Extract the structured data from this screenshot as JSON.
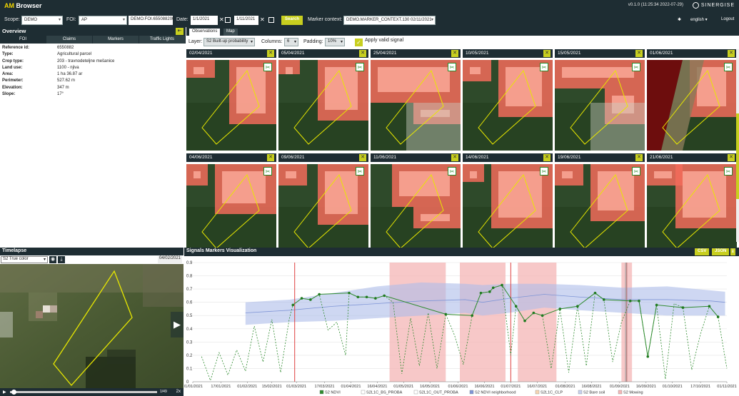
{
  "header": {
    "brand_am": "AM",
    "brand_rest": " Browser",
    "version": "v0.1.0 (11:25:34 2022-07-29)",
    "company": "SINERGISE",
    "scope_label": "Scope:",
    "scope_value": "DEMO",
    "foi_label": "FOI:",
    "foi_value": "AP",
    "foi_id": "DEMO.FOI.655088200",
    "date_label": "Date:",
    "date_from": "1/1/2021",
    "date_to": "1/11/2021",
    "search_label": "Search",
    "marker_label": "Marker context:",
    "marker_value": "DEMO.MARKER_CONTEXT.130 02/11/2021",
    "settings_icon": "gear-icon",
    "language": "english",
    "logout": "Logout"
  },
  "overview": {
    "title": "Overview",
    "tabs": [
      "FOI",
      "Claims",
      "Markers",
      "Traffic Lights"
    ],
    "properties": [
      {
        "k": "Reference id:",
        "v": "6550882"
      },
      {
        "k": "Type:",
        "v": "Agricultural parcel"
      },
      {
        "k": "Crop type:",
        "v": "203 - travnodeteljne mešanice"
      },
      {
        "k": "Land use:",
        "v": "1100 - njiva"
      },
      {
        "k": "Area:",
        "v": "1 ha 36.87 ar"
      },
      {
        "k": "Perimeter:",
        "v": "527.62 m"
      },
      {
        "k": "Elevation:",
        "v": "347 m"
      },
      {
        "k": "Slope:",
        "v": "17°"
      }
    ]
  },
  "gallery": {
    "tabs": [
      "Observations",
      "Map"
    ],
    "layer_label": "Layer:",
    "layer_value": "S2 Built-up probability",
    "columns_label": "Columns:",
    "columns_value": "6",
    "padding_label": "Padding:",
    "padding_value": "10%",
    "valid_signal_label": "Apply valid signal",
    "observations": [
      "02/04/2021",
      "05/04/2021",
      "25/04/2021",
      "10/05/2021",
      "15/05/2021",
      "01/06/2021",
      "04/06/2021",
      "09/06/2021",
      "11/06/2021",
      "14/06/2021",
      "19/06/2021",
      "21/06/2021"
    ]
  },
  "timelapse": {
    "title": "Timelapse",
    "layer": "S2 True color",
    "date": "04/02/2021",
    "counter": "1/49",
    "speed": "2x"
  },
  "signals": {
    "title": "Signals Markers Visualization",
    "csv_label": "CSV",
    "json_label": "JSON"
  },
  "colors": {
    "header_bg": "#1e2d33",
    "accent": "#c8cf1f",
    "ndvi": "#2e8b2e",
    "mowing": "#f4b6b6",
    "bare_soil": "#c6d0ee"
  },
  "chart_data": {
    "type": "line",
    "ylim": [
      0,
      0.9
    ],
    "yticks": [
      "0",
      "0.1",
      "0.2",
      "0.3",
      "0.4",
      "0.5",
      "0.6",
      "0.7",
      "0.8",
      "0.9"
    ],
    "xticks": [
      "01/01/2021",
      "17/01/2021",
      "01/02/2021",
      "15/02/2021",
      "01/03/2021",
      "17/03/2021",
      "01/04/2021",
      "16/04/2021",
      "01/05/2021",
      "16/05/2021",
      "01/06/2021",
      "16/06/2021",
      "01/07/2021",
      "16/07/2021",
      "01/08/2021",
      "16/08/2021",
      "01/09/2021",
      "16/09/2021",
      "01/10/2021",
      "17/10/2021",
      "01/11/2021"
    ],
    "xrange_days": [
      0,
      304
    ],
    "legend": [
      "S2 NDVI",
      "S2L1C_BS_PROBA",
      "S2L1C_OUT_PROBA",
      "S2 NDVI neighborhood",
      "S2L1C_CLP",
      "S2 Bare soil",
      "S2 Mowing"
    ],
    "mowing_events": [
      {
        "start": "2021-04-23",
        "end": "2021-05-25"
      },
      {
        "start": "2021-06-02",
        "end": "2021-06-28"
      },
      {
        "start": "2021-07-05",
        "end": "2021-07-27"
      },
      {
        "start": "2021-09-02",
        "end": "2021-09-08"
      }
    ],
    "red_markers": [
      "2021-02-28",
      "2021-07-01",
      "2021-09-05"
    ],
    "ndvi_neighborhood": {
      "x": [
        "2021-01-31",
        "2021-02-25",
        "2021-03-22",
        "2021-04-16",
        "2021-05-11",
        "2021-06-05",
        "2021-06-15",
        "2021-06-30",
        "2021-07-20",
        "2021-08-09",
        "2021-09-03",
        "2021-09-28",
        "2021-10-23",
        "2021-10-31"
      ],
      "mean": [
        0.52,
        0.54,
        0.57,
        0.59,
        0.61,
        0.62,
        0.6,
        0.63,
        0.66,
        0.64,
        0.62,
        0.62,
        0.61,
        0.6
      ],
      "low": [
        0.43,
        0.45,
        0.46,
        0.48,
        0.5,
        0.52,
        0.5,
        0.52,
        0.56,
        0.54,
        0.52,
        0.5,
        0.5,
        0.5
      ],
      "high": [
        0.6,
        0.62,
        0.67,
        0.72,
        0.75,
        0.74,
        0.73,
        0.74,
        0.74,
        0.73,
        0.71,
        0.72,
        0.69,
        0.68
      ]
    },
    "ndvi_valid": {
      "x": [
        "2021-02-27",
        "2021-03-04",
        "2021-03-09",
        "2021-03-14",
        "2021-03-31",
        "2021-04-05",
        "2021-04-10",
        "2021-04-15",
        "2021-04-20",
        "2021-05-25",
        "2021-06-09",
        "2021-06-14",
        "2021-06-19",
        "2021-06-21",
        "2021-06-26",
        "2021-07-04",
        "2021-07-09",
        "2021-07-14",
        "2021-07-19",
        "2021-07-29",
        "2021-08-08",
        "2021-08-18",
        "2021-08-23",
        "2021-09-07",
        "2021-09-12",
        "2021-09-17",
        "2021-09-22",
        "2021-10-07",
        "2021-10-22",
        "2021-10-27"
      ],
      "y": [
        0.58,
        0.63,
        0.62,
        0.66,
        0.67,
        0.64,
        0.64,
        0.63,
        0.65,
        0.51,
        0.5,
        0.67,
        0.68,
        0.71,
        0.73,
        0.57,
        0.46,
        0.52,
        0.5,
        0.55,
        0.57,
        0.67,
        0.62,
        0.61,
        0.61,
        0.19,
        0.58,
        0.56,
        0.57,
        0.49
      ]
    },
    "ndvi_all": {
      "x": [
        "2021-01-06",
        "2021-01-11",
        "2021-01-16",
        "2021-01-21",
        "2021-01-26",
        "2021-01-31",
        "2021-02-05",
        "2021-02-10",
        "2021-02-15",
        "2021-02-20",
        "2021-02-25",
        "2021-02-27",
        "2021-03-04",
        "2021-03-09",
        "2021-03-14",
        "2021-03-19",
        "2021-03-24",
        "2021-03-29",
        "2021-03-31",
        "2021-04-05",
        "2021-04-10",
        "2021-04-15",
        "2021-04-20",
        "2021-04-25",
        "2021-04-30",
        "2021-05-05",
        "2021-05-10",
        "2021-05-15",
        "2021-05-20",
        "2021-05-25",
        "2021-05-30",
        "2021-06-04",
        "2021-06-09",
        "2021-06-14",
        "2021-06-19",
        "2021-06-21",
        "2021-06-26",
        "2021-07-01",
        "2021-07-04",
        "2021-07-09",
        "2021-07-14",
        "2021-07-19",
        "2021-07-24",
        "2021-07-29",
        "2021-08-03",
        "2021-08-08",
        "2021-08-13",
        "2021-08-18",
        "2021-08-23",
        "2021-08-28",
        "2021-09-02",
        "2021-09-07",
        "2021-09-12",
        "2021-09-17",
        "2021-09-22",
        "2021-09-27",
        "2021-10-02",
        "2021-10-07",
        "2021-10-12",
        "2021-10-17",
        "2021-10-22",
        "2021-10-27",
        "2021-11-01"
      ],
      "y": [
        0.19,
        0.01,
        0.22,
        0.05,
        0.24,
        0.08,
        0.42,
        0.15,
        0.47,
        0.07,
        0.48,
        0.58,
        0.63,
        0.62,
        0.66,
        0.39,
        0.45,
        0.2,
        0.67,
        0.64,
        0.64,
        0.63,
        0.65,
        0.6,
        0.06,
        0.48,
        0.12,
        0.52,
        0.1,
        0.51,
        0.35,
        0.13,
        0.5,
        0.67,
        0.68,
        0.71,
        0.73,
        0.2,
        0.57,
        0.46,
        0.52,
        0.5,
        0.1,
        0.55,
        0.07,
        0.57,
        0.12,
        0.67,
        0.62,
        0.15,
        0.45,
        0.61,
        0.61,
        0.19,
        0.58,
        0.02,
        0.59,
        0.56,
        0.09,
        0.36,
        0.57,
        0.49,
        0.1
      ]
    }
  }
}
